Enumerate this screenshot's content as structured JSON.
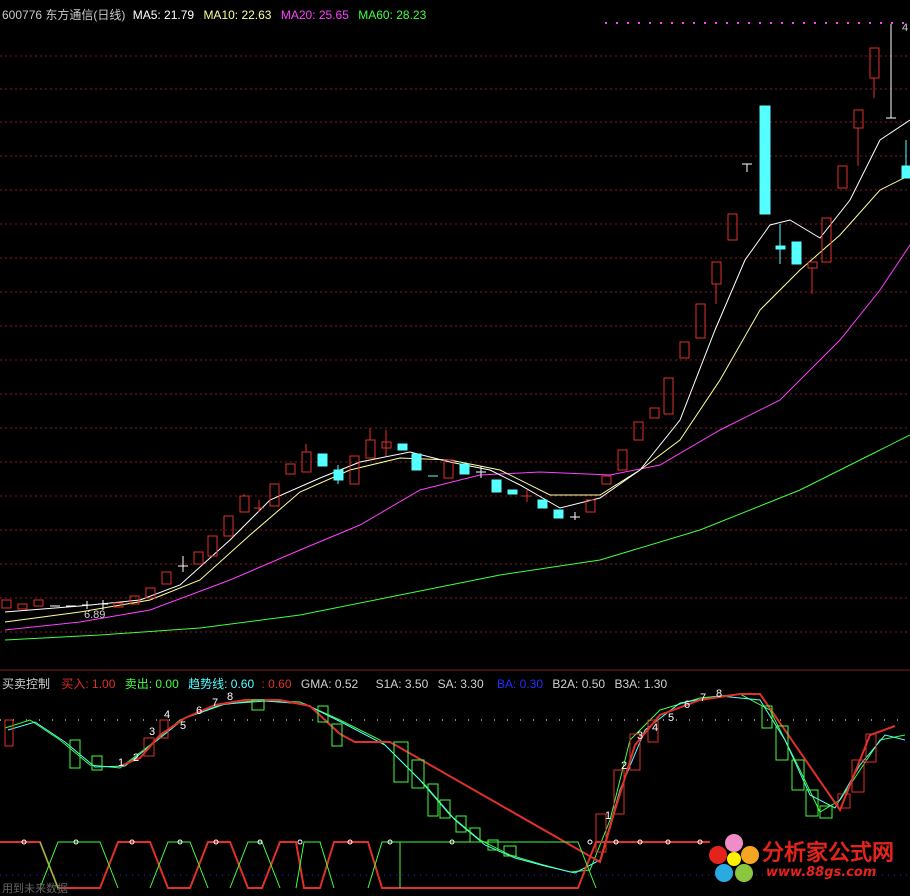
{
  "header": {
    "stock": "600776 东方通信(日线)",
    "ma5": "MA5: 21.79",
    "ma10": "MA10: 22.63",
    "ma20": "MA20: 25.65",
    "ma60": "MA60: 28.23",
    "low_label": "6.89",
    "high_label": "4"
  },
  "indicator": {
    "name": "买卖控制",
    "buy": "买入: 1.00",
    "sell": "卖出: 0.00",
    "trend": "趋势线: 0.60",
    "trend2": ": 0.60",
    "gma": "GMA: 0.52",
    "s1a": "S1A: 3.50",
    "sa": "SA: 3.30",
    "ba": "BA: 0.30",
    "b2a": "B2A: 0.50",
    "b3a": "B3A: 1.30",
    "note": "用到未来数据"
  },
  "logo": {
    "name": "分析家公式网",
    "url": "www.88gs.com"
  },
  "colors": {
    "up": "#e0302a",
    "down": "#54ffff",
    "ma5": "#ffffff",
    "ma10": "#ffff9a",
    "ma20": "#ff40ff",
    "ma60": "#40ff40",
    "grid": "#8a1a1a"
  },
  "series": {
    "wave_marks": [
      "1",
      "2",
      "3",
      "4",
      "5",
      "6",
      "7",
      "8"
    ]
  }
}
